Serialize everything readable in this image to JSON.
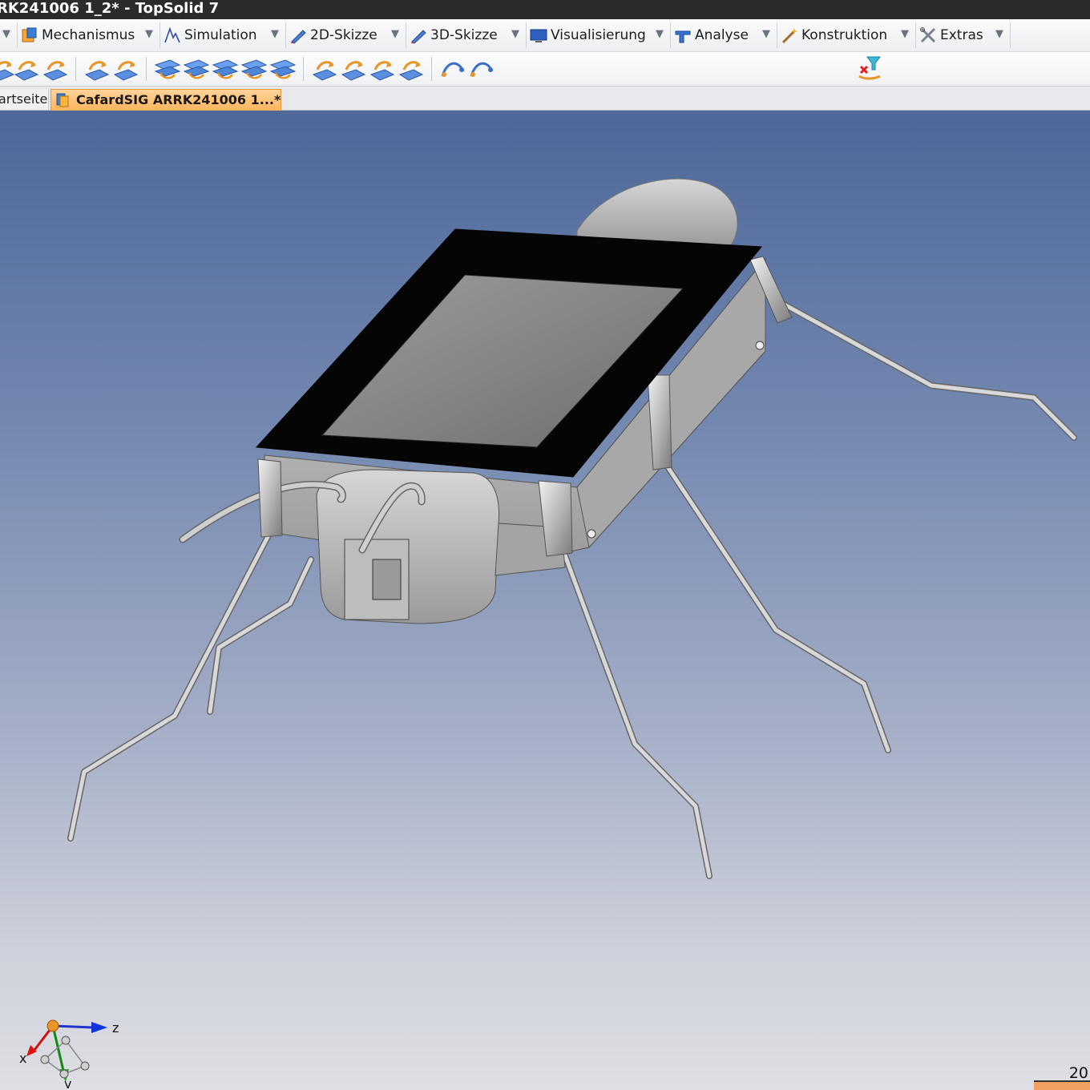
{
  "window": {
    "title": "RK241006 1_2* - TopSolid 7"
  },
  "menu": {
    "items": [
      {
        "label": "Mechanismus",
        "icon": "mechanism-icon"
      },
      {
        "label": "Simulation",
        "icon": "simulation-icon"
      },
      {
        "label": "2D-Skizze",
        "icon": "sketch-2d-icon"
      },
      {
        "label": "3D-Skizze",
        "icon": "sketch-3d-icon"
      },
      {
        "label": "Visualisierung",
        "icon": "display-icon"
      },
      {
        "label": "Analyse",
        "icon": "analysis-icon"
      },
      {
        "label": "Konstruktion",
        "icon": "construction-wand-icon"
      },
      {
        "label": "Extras",
        "icon": "tools-icon"
      }
    ],
    "dropdown_glyph": "▼"
  },
  "tabs": {
    "start_label": "artseite",
    "active_label": "CafardSIG ARRK241006 1...*"
  },
  "viewport": {
    "triad": {
      "x_label": "x",
      "y_label": "y",
      "z_label": "z"
    },
    "scale_label": "20"
  },
  "colors": {
    "accent_tab": "#ffb45c",
    "axis_x": "#d11",
    "axis_y": "#1a1",
    "axis_z": "#1133dd"
  }
}
